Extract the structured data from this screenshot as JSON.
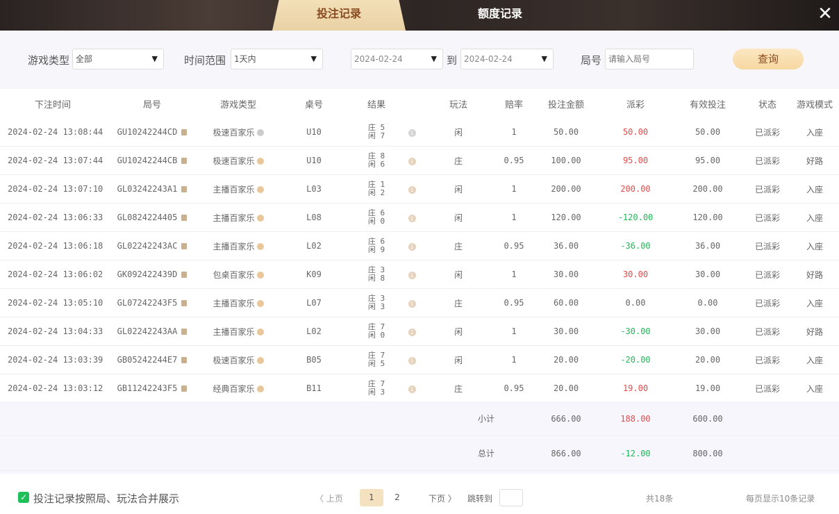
{
  "tabs": [
    {
      "label": "投注记录",
      "active": true
    },
    {
      "label": "额度记录",
      "active": false
    }
  ],
  "close_icon": "close-icon",
  "filters": {
    "game_type_label": "游戏类型",
    "game_type_value": "全部",
    "time_range_label": "时间范围",
    "time_range_value": "1天内",
    "date_from": "2024-02-24",
    "to_label": "到",
    "date_to": "2024-02-24",
    "round_label": "局号",
    "round_placeholder": "请输入局号",
    "query_label": "查询"
  },
  "columns": [
    "下注时间",
    "局号",
    "游戏类型",
    "桌号",
    "结果",
    "玩法",
    "赔率",
    "投注金额",
    "派彩",
    "有效投注",
    "状态",
    "游戏模式"
  ],
  "rows": [
    {
      "time": "2024-02-24 13:08:44",
      "round": "GU10242244CD",
      "game": "极速百家乐",
      "table": "U10",
      "banker": "庄 5",
      "player": "闲 7",
      "bet": "闲",
      "odds": "1",
      "amount": "50.00",
      "payout": "50.00",
      "payout_color": "red",
      "valid": "50.00",
      "status": "已派彩",
      "mode": "入座",
      "grey": true
    },
    {
      "time": "2024-02-24 13:07:44",
      "round": "GU10242244CB",
      "game": "极速百家乐",
      "table": "U10",
      "banker": "庄 8",
      "player": "闲 6",
      "bet": "庄",
      "odds": "0.95",
      "amount": "100.00",
      "payout": "95.00",
      "payout_color": "red",
      "valid": "95.00",
      "status": "已派彩",
      "mode": "好路"
    },
    {
      "time": "2024-02-24 13:07:10",
      "round": "GL03242243A1",
      "game": "主播百家乐",
      "table": "L03",
      "banker": "庄 1",
      "player": "闲 2",
      "bet": "闲",
      "odds": "1",
      "amount": "200.00",
      "payout": "200.00",
      "payout_color": "red",
      "valid": "200.00",
      "status": "已派彩",
      "mode": "入座"
    },
    {
      "time": "2024-02-24 13:06:33",
      "round": "GL0824224405",
      "game": "主播百家乐",
      "table": "L08",
      "banker": "庄 6",
      "player": "闲 0",
      "bet": "闲",
      "odds": "1",
      "amount": "120.00",
      "payout": "-120.00",
      "payout_color": "green",
      "valid": "120.00",
      "status": "已派彩",
      "mode": "入座"
    },
    {
      "time": "2024-02-24 13:06:18",
      "round": "GL02242243AC",
      "game": "主播百家乐",
      "table": "L02",
      "banker": "庄 6",
      "player": "闲 9",
      "bet": "庄",
      "odds": "0.95",
      "amount": "36.00",
      "payout": "-36.00",
      "payout_color": "green",
      "valid": "36.00",
      "status": "已派彩",
      "mode": "入座"
    },
    {
      "time": "2024-02-24 13:06:02",
      "round": "GK092422439D",
      "game": "包桌百家乐",
      "table": "K09",
      "banker": "庄 3",
      "player": "闲 8",
      "bet": "闲",
      "odds": "1",
      "amount": "30.00",
      "payout": "30.00",
      "payout_color": "red",
      "valid": "30.00",
      "status": "已派彩",
      "mode": "好路"
    },
    {
      "time": "2024-02-24 13:05:10",
      "round": "GL07242243F5",
      "game": "主播百家乐",
      "table": "L07",
      "banker": "庄 3",
      "player": "闲 3",
      "bet": "庄",
      "odds": "0.95",
      "amount": "60.00",
      "payout": "0.00",
      "payout_color": "plain",
      "valid": "0.00",
      "status": "已派彩",
      "mode": "入座"
    },
    {
      "time": "2024-02-24 13:04:33",
      "round": "GL02242243AA",
      "game": "主播百家乐",
      "table": "L02",
      "banker": "庄 7",
      "player": "闲 0",
      "bet": "闲",
      "odds": "1",
      "amount": "30.00",
      "payout": "-30.00",
      "payout_color": "green",
      "valid": "30.00",
      "status": "已派彩",
      "mode": "好路"
    },
    {
      "time": "2024-02-24 13:03:39",
      "round": "GB05242244E7",
      "game": "极速百家乐",
      "table": "B05",
      "banker": "庄 7",
      "player": "闲 5",
      "bet": "闲",
      "odds": "1",
      "amount": "20.00",
      "payout": "-20.00",
      "payout_color": "green",
      "valid": "20.00",
      "status": "已派彩",
      "mode": "入座"
    },
    {
      "time": "2024-02-24 13:03:12",
      "round": "GB11242243F5",
      "game": "经典百家乐",
      "table": "B11",
      "banker": "庄 7",
      "player": "闲 3",
      "bet": "庄",
      "odds": "0.95",
      "amount": "20.00",
      "payout": "19.00",
      "payout_color": "red",
      "valid": "19.00",
      "status": "已派彩",
      "mode": "入座"
    }
  ],
  "summary": [
    {
      "label": "小计",
      "amount": "666.00",
      "payout": "188.00",
      "payout_color": "red",
      "valid": "600.00"
    },
    {
      "label": "总计",
      "amount": "866.00",
      "payout": "-12.00",
      "payout_color": "green",
      "valid": "800.00"
    }
  ],
  "footer": {
    "merge_label": "投注记录按照局、玩法合并展示",
    "merge_checked": true,
    "prev": "〈 上页",
    "pages": [
      "1",
      "2"
    ],
    "current_page": "1",
    "next": "下页 〉",
    "jump_label": "跳转到",
    "total": "共18条",
    "per_page": "每页显示10条记录"
  },
  "colors": {
    "red": "#e54a4a",
    "green": "#1db856",
    "accent": "#f3e1bf"
  }
}
